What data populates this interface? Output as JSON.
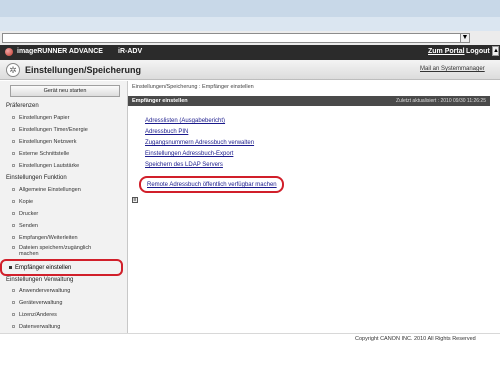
{
  "browser": {
    "address_value": "",
    "dropdown_glyph": "▼"
  },
  "appbar": {
    "product_name": "imageRUNNER ADVANCE",
    "product_sub": "iR-ADV",
    "portal_link": "Zum Portal",
    "logout_link": "Logout",
    "scroll_glyph": "▲"
  },
  "header": {
    "title": "Einstellungen/Speicherung",
    "mail_link": "Mail an Systemmanager"
  },
  "sidebar": {
    "restart_button": "Gerät neu starten",
    "section_preferences": "Präferenzen",
    "preferences_items": [
      "Einstellungen Papier",
      "Einstellungen Timer/Energie",
      "Einstellungen Netzwerk",
      "Externe Schnittstelle",
      "Einstellungen Lautstärke"
    ],
    "section_function": "Einstellungen Funktion",
    "function_items": [
      "Allgemeine Einstellungen",
      "Kopie",
      "Drucker",
      "Senden",
      "Empfangen/Weiterleiten"
    ],
    "function_multiline_line1": "Dateien speichern/zugänglich",
    "function_multiline_line2": "machen",
    "active_item": "Empfänger einstellen",
    "section_management": "Einstellungen Verwaltung",
    "management_items": [
      "Anwenderverwaltung",
      "Geräteverwaltung",
      "Lizenz/Anderes",
      "Datenverwaltung"
    ]
  },
  "main": {
    "breadcrumb": "Einstellungen/Speicherung : Empfänger einstellen",
    "panel_title": "Empfänger einstellen",
    "panel_updated": "Zuletzt aktualisiert : 2010 09/30 11:26:25",
    "links": [
      "Adresslisten (Ausgabebericht)",
      "Adressbuch PIN",
      "Zugangsnummern Adressbuch verwalten",
      "Einstellungen Adressbuch-Export",
      "Speichern des LDAP Servers",
      "Remote Adressbuch öffentlich verfügbar machen"
    ],
    "top_glyph": "≡"
  },
  "footer": {
    "copyright": "Copyright CANON INC. 2010 All Rights Reserved"
  },
  "colors": {
    "highlight": "#d11f2a",
    "appbar": "#2b2b2b",
    "panel_header": "#4a4a4a",
    "link": "#1a1a8c"
  }
}
